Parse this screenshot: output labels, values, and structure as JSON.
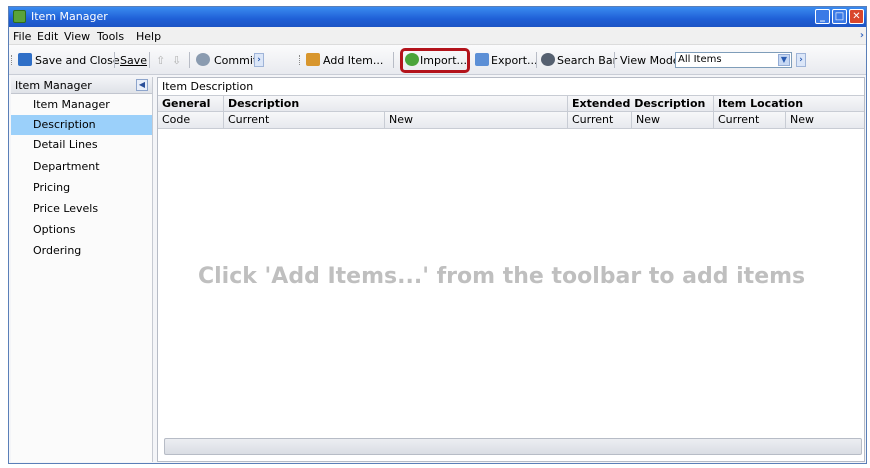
{
  "window": {
    "title": "Item Manager"
  },
  "menu": {
    "items": [
      "File",
      "Edit",
      "View",
      "Tools",
      "Help"
    ]
  },
  "toolbar": {
    "save_close": "Save and Close",
    "save": "Save",
    "commit": "Commit",
    "add_item": "Add Item...",
    "import": "Import...",
    "export": "Export...",
    "search_bar": "Search Bar",
    "view_mode_label": "View Mode",
    "view_mode_value": "All Items"
  },
  "sidebar": {
    "header": "Item Manager",
    "items": [
      "Item Manager",
      "Description",
      "Detail Lines",
      "Department",
      "Pricing",
      "Price Levels",
      "Options",
      "Ordering"
    ],
    "selected_index": 1
  },
  "main": {
    "tab": "Item Description",
    "group_headers": [
      "General",
      "Description",
      "Extended Description",
      "Item Location"
    ],
    "columns": [
      "Code",
      "Current",
      "New",
      "Current",
      "New",
      "Current",
      "New"
    ],
    "empty_message": "Click 'Add Items...' from the toolbar to add items"
  },
  "colors": {
    "highlight": "#b3131b",
    "selected_row": "#9bd0fa",
    "titlebar": "#1f5fd6"
  }
}
